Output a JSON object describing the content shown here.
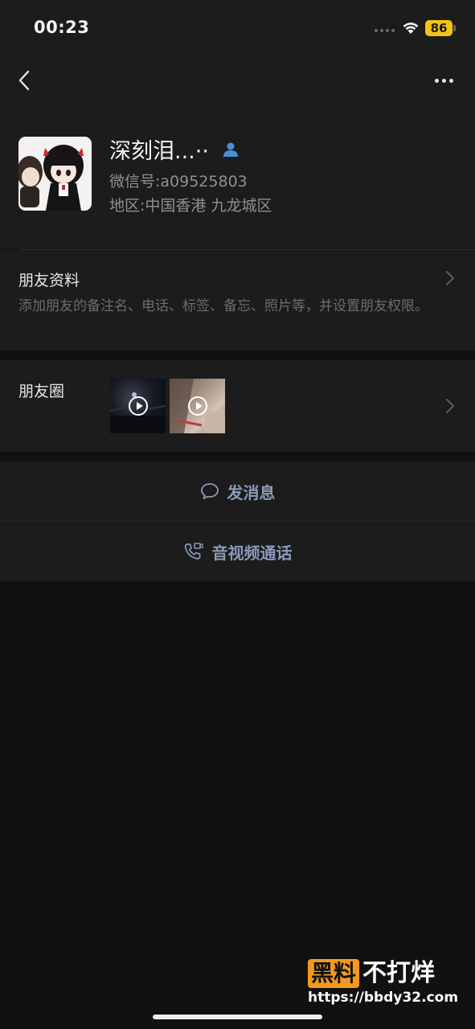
{
  "status_bar": {
    "time": "00:23",
    "battery_level": "86",
    "battery_color": "#f0c419",
    "icons": [
      "cellular-signal-icon",
      "wifi-icon",
      "battery-icon"
    ]
  },
  "nav": {
    "back_icon": "chevron-left-icon",
    "more_icon": "more-dots-icon"
  },
  "profile": {
    "name": "深刻泪...··",
    "contact_icon": "contact-person-icon",
    "wechat_id": "微信号:a09525803",
    "region": "地区:中国香港 九龙城区"
  },
  "friend_info": {
    "title": "朋友资料",
    "description": "添加朋友的备注名、电话、标签、备忘、照片等，并设置朋友权限。"
  },
  "moments": {
    "title": "朋友圈",
    "thumbnails": [
      {
        "type": "video",
        "icon": "play-icon"
      },
      {
        "type": "video",
        "icon": "play-icon"
      }
    ]
  },
  "actions": {
    "send_message": "发消息",
    "send_message_icon": "chat-bubble-icon",
    "call": "音视频通话",
    "call_icon": "phone-video-call-icon",
    "accent_color": "#8a9ab8"
  },
  "watermark": {
    "badge": "黑料",
    "text": "不打烊",
    "url": "https://bbdy32.com"
  }
}
